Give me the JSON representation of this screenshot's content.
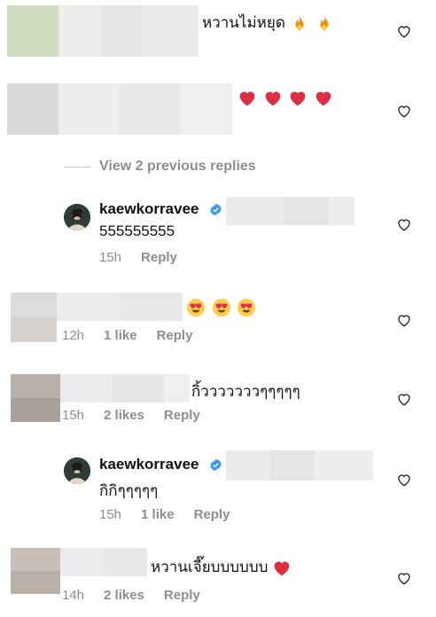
{
  "comments": [
    {
      "text": "หวานไม่หยุด",
      "emoji": [
        "fire",
        "fire"
      ]
    },
    {
      "text": "",
      "emoji": [
        "red-heart",
        "red-heart",
        "red-heart",
        "red-heart"
      ]
    },
    {
      "text": "",
      "emoji": [
        "heart-eyes",
        "heart-eyes",
        "heart-eyes"
      ],
      "time": "12h",
      "likes": "1 like",
      "reply": "Reply"
    },
    {
      "text": "กิ้วววววววๆๆๆๆๆ",
      "time": "15h",
      "likes": "2 likes",
      "reply": "Reply"
    },
    {
      "text": "หวานเจี๊ยบบบบบบ",
      "emoji": [
        "red-heart"
      ],
      "time": "14h",
      "likes": "2 likes",
      "reply": "Reply"
    }
  ],
  "view_replies": "View 2 previous replies",
  "replies": [
    {
      "username": "kaewkorravee",
      "text": "555555555",
      "time": "15h",
      "reply": "Reply"
    },
    {
      "username": "kaewkorravee",
      "text": "กิกิๆๆๆๆๆ",
      "time": "15h",
      "likes": "1 like",
      "reply": "Reply"
    }
  ],
  "icons": {
    "like": "heart-outline-icon",
    "verified": "verified-badge-icon"
  },
  "colors": {
    "verified": "#3897f0",
    "heart": "#e0245e",
    "meta": "#8e8e8e"
  }
}
